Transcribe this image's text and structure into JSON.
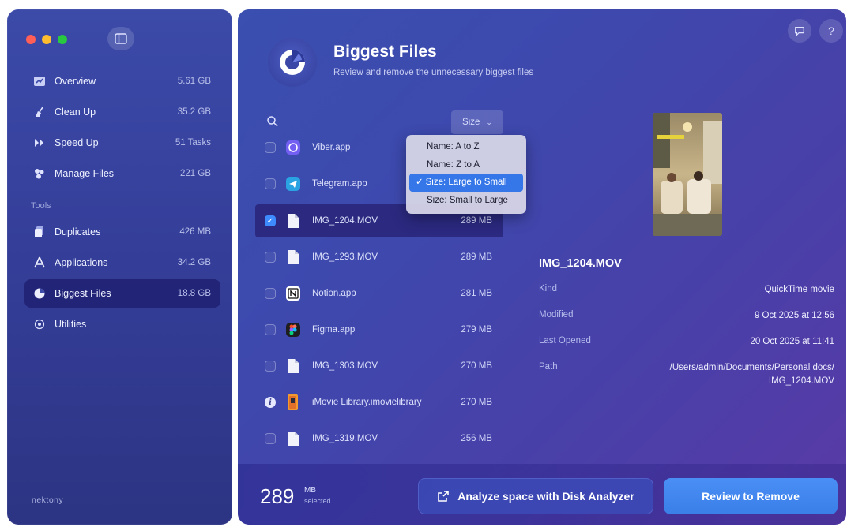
{
  "sidebar": {
    "items": [
      {
        "label": "Overview",
        "value": "5.61 GB",
        "icon": "overview-icon"
      },
      {
        "label": "Clean Up",
        "value": "35.2 GB",
        "icon": "broom-icon"
      },
      {
        "label": "Speed Up",
        "value": "51 Tasks",
        "icon": "speed-icon"
      },
      {
        "label": "Manage Files",
        "value": "221 GB",
        "icon": "manage-files-icon"
      }
    ],
    "tools_label": "Tools",
    "tools": [
      {
        "label": "Duplicates",
        "value": "426 MB",
        "icon": "duplicates-icon"
      },
      {
        "label": "Applications",
        "value": "34.2 GB",
        "icon": "applications-icon"
      },
      {
        "label": "Biggest Files",
        "value": "18.8 GB",
        "icon": "biggest-files-icon",
        "active": true
      },
      {
        "label": "Utilities",
        "value": "",
        "icon": "utilities-icon"
      }
    ],
    "brand": "nektony"
  },
  "header": {
    "title": "Biggest Files",
    "subtitle": "Review and remove the unnecessary biggest files"
  },
  "sort": {
    "label": "Size",
    "options": [
      "Name: A to Z",
      "Name: Z to A",
      "Size: Large to Small",
      "Size: Small to Large"
    ],
    "selected": "Size: Large to Small"
  },
  "files": [
    {
      "name": "Viber.app",
      "size": "",
      "checked": false,
      "icon": "viber-icon"
    },
    {
      "name": "Telegram.app",
      "size": "",
      "checked": false,
      "icon": "telegram-icon"
    },
    {
      "name": "IMG_1204.MOV",
      "size": "289 MB",
      "checked": true,
      "icon": "file-icon"
    },
    {
      "name": "IMG_1293.MOV",
      "size": "289 MB",
      "checked": false,
      "icon": "file-icon"
    },
    {
      "name": "Notion.app",
      "size": "281 MB",
      "checked": false,
      "icon": "notion-icon"
    },
    {
      "name": "Figma.app",
      "size": "279 MB",
      "checked": false,
      "icon": "figma-icon"
    },
    {
      "name": "IMG_1303.MOV",
      "size": "270 MB",
      "checked": false,
      "icon": "file-icon"
    },
    {
      "name": "iMovie Library.imovielibrary",
      "size": "270 MB",
      "checked": false,
      "icon": "imovie-library-icon",
      "info": true
    },
    {
      "name": "IMG_1319.MOV",
      "size": "256 MB",
      "checked": false,
      "icon": "file-icon"
    }
  ],
  "details": {
    "name": "IMG_1204.MOV",
    "kind_label": "Kind",
    "kind": "QuickTime movie",
    "modified_label": "Modified",
    "modified": "9 Oct 2025 at 12:56",
    "opened_label": "Last Opened",
    "opened": "20 Oct 2025 at 11:41",
    "path_label": "Path",
    "path_line1": "/Users/admin/Documents/Personal docs/",
    "path_line2": "IMG_1204.MOV"
  },
  "bottom": {
    "selected_size": "289",
    "selected_unit": "MB",
    "selected_label": "selected",
    "analyze_label": "Analyze space with Disk Analyzer",
    "review_label": "Review to Remove"
  },
  "colors": {
    "accent": "#3d8bff",
    "menu_highlight": "#3576e8",
    "sidebar_bg": "#353f9a",
    "main_bg": "#3e48ad"
  }
}
